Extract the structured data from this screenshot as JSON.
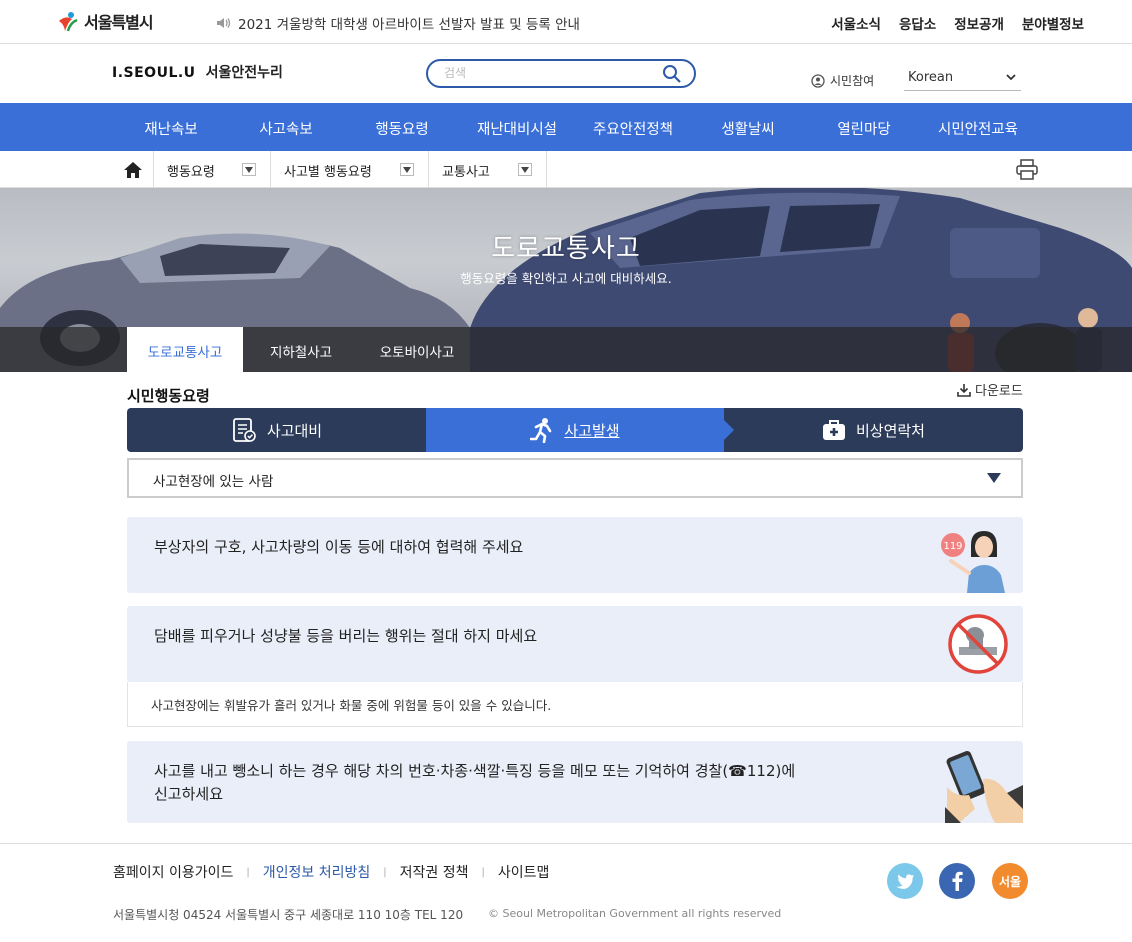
{
  "topbar": {
    "logo_text": "서울특별시",
    "notice": "2021 겨울방학 대학생 아르바이트 선발자 발표 및 등록 안내",
    "links": [
      "서울소식",
      "응답소",
      "정보공개",
      "분야별정보"
    ]
  },
  "header": {
    "brand_en": "I.SEOUL.U",
    "brand_ko": "서울안전누리",
    "search_placeholder": "검색",
    "civic_label": "시민참여",
    "language": "Korean"
  },
  "gnb": {
    "items": [
      "재난속보",
      "사고속보",
      "행동요령",
      "재난대비시설",
      "주요안전정책",
      "생활날씨",
      "열린마당",
      "시민안전교육"
    ]
  },
  "breadcrumb": {
    "items": [
      "행동요령",
      "사고별 행동요령",
      "교통사고"
    ]
  },
  "hero": {
    "title": "도로교통사고",
    "subtitle": "행동요령을 확인하고 사고에 대비하세요.",
    "tabs": [
      "도로교통사고",
      "지하철사고",
      "오토바이사고"
    ],
    "active_tab": "도로교통사고"
  },
  "section": {
    "title": "시민행동요령",
    "download_label": "다운로드",
    "steps": [
      "사고대비",
      "사고발생",
      "비상연락처"
    ],
    "active_step": "사고발생",
    "select_value": "사고현장에 있는 사람"
  },
  "cards": [
    {
      "text": "부상자의 구호, 사고차량의 이동 등에 대하여 협력해 주세요",
      "badge": "119"
    },
    {
      "text": "담배를 피우거나 성냥불 등을 버리는 행위는 절대 하지 마세요",
      "detail": "사고현장에는 휘발유가 흘러 있거나 화물 중에 위험물 등이 있을 수 있습니다."
    },
    {
      "text_line1": "사고를 내고 뺑소니 하는 경우 해당 차의 번호·차종·색깔·특징 등을 메모 또는 기억하여 경찰(☎112)에",
      "text_line2": "신고하세요"
    }
  ],
  "footer": {
    "links": [
      "홈페이지 이용가이드",
      "개인정보 처리방침",
      "저작권 정책",
      "사이트맵"
    ],
    "address": "서울특별시청 04524 서울특별시 중구 세종대로 110 10층 TEL 120",
    "copyright": "© Seoul Metropolitan Government all rights reserved",
    "sns": [
      "twitter",
      "facebook",
      "seoul"
    ],
    "seoul_glyph": "서울"
  },
  "colors": {
    "primary": "#3a6fd8",
    "navy": "#2c3b5a",
    "card_bg": "#e9eef9",
    "twitter": "#7cc8ea",
    "facebook": "#3b67b2",
    "seoul": "#f28a2e"
  }
}
